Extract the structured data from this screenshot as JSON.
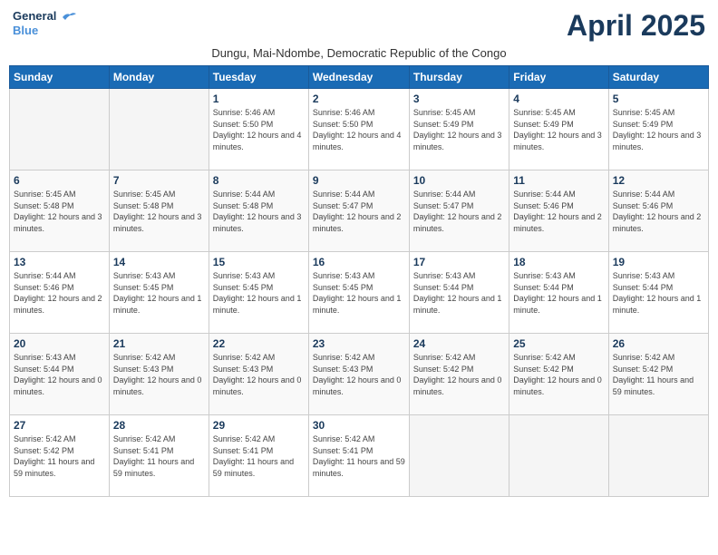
{
  "header": {
    "logo_line1": "General",
    "logo_line2": "Blue",
    "month": "April 2025",
    "subtitle": "Dungu, Mai-Ndombe, Democratic Republic of the Congo"
  },
  "days_of_week": [
    "Sunday",
    "Monday",
    "Tuesday",
    "Wednesday",
    "Thursday",
    "Friday",
    "Saturday"
  ],
  "weeks": [
    [
      {
        "num": "",
        "info": ""
      },
      {
        "num": "",
        "info": ""
      },
      {
        "num": "1",
        "info": "Sunrise: 5:46 AM\nSunset: 5:50 PM\nDaylight: 12 hours and 4 minutes."
      },
      {
        "num": "2",
        "info": "Sunrise: 5:46 AM\nSunset: 5:50 PM\nDaylight: 12 hours and 4 minutes."
      },
      {
        "num": "3",
        "info": "Sunrise: 5:45 AM\nSunset: 5:49 PM\nDaylight: 12 hours and 3 minutes."
      },
      {
        "num": "4",
        "info": "Sunrise: 5:45 AM\nSunset: 5:49 PM\nDaylight: 12 hours and 3 minutes."
      },
      {
        "num": "5",
        "info": "Sunrise: 5:45 AM\nSunset: 5:49 PM\nDaylight: 12 hours and 3 minutes."
      }
    ],
    [
      {
        "num": "6",
        "info": "Sunrise: 5:45 AM\nSunset: 5:48 PM\nDaylight: 12 hours and 3 minutes."
      },
      {
        "num": "7",
        "info": "Sunrise: 5:45 AM\nSunset: 5:48 PM\nDaylight: 12 hours and 3 minutes."
      },
      {
        "num": "8",
        "info": "Sunrise: 5:44 AM\nSunset: 5:48 PM\nDaylight: 12 hours and 3 minutes."
      },
      {
        "num": "9",
        "info": "Sunrise: 5:44 AM\nSunset: 5:47 PM\nDaylight: 12 hours and 2 minutes."
      },
      {
        "num": "10",
        "info": "Sunrise: 5:44 AM\nSunset: 5:47 PM\nDaylight: 12 hours and 2 minutes."
      },
      {
        "num": "11",
        "info": "Sunrise: 5:44 AM\nSunset: 5:46 PM\nDaylight: 12 hours and 2 minutes."
      },
      {
        "num": "12",
        "info": "Sunrise: 5:44 AM\nSunset: 5:46 PM\nDaylight: 12 hours and 2 minutes."
      }
    ],
    [
      {
        "num": "13",
        "info": "Sunrise: 5:44 AM\nSunset: 5:46 PM\nDaylight: 12 hours and 2 minutes."
      },
      {
        "num": "14",
        "info": "Sunrise: 5:43 AM\nSunset: 5:45 PM\nDaylight: 12 hours and 1 minute."
      },
      {
        "num": "15",
        "info": "Sunrise: 5:43 AM\nSunset: 5:45 PM\nDaylight: 12 hours and 1 minute."
      },
      {
        "num": "16",
        "info": "Sunrise: 5:43 AM\nSunset: 5:45 PM\nDaylight: 12 hours and 1 minute."
      },
      {
        "num": "17",
        "info": "Sunrise: 5:43 AM\nSunset: 5:44 PM\nDaylight: 12 hours and 1 minute."
      },
      {
        "num": "18",
        "info": "Sunrise: 5:43 AM\nSunset: 5:44 PM\nDaylight: 12 hours and 1 minute."
      },
      {
        "num": "19",
        "info": "Sunrise: 5:43 AM\nSunset: 5:44 PM\nDaylight: 12 hours and 1 minute."
      }
    ],
    [
      {
        "num": "20",
        "info": "Sunrise: 5:43 AM\nSunset: 5:44 PM\nDaylight: 12 hours and 0 minutes."
      },
      {
        "num": "21",
        "info": "Sunrise: 5:42 AM\nSunset: 5:43 PM\nDaylight: 12 hours and 0 minutes."
      },
      {
        "num": "22",
        "info": "Sunrise: 5:42 AM\nSunset: 5:43 PM\nDaylight: 12 hours and 0 minutes."
      },
      {
        "num": "23",
        "info": "Sunrise: 5:42 AM\nSunset: 5:43 PM\nDaylight: 12 hours and 0 minutes."
      },
      {
        "num": "24",
        "info": "Sunrise: 5:42 AM\nSunset: 5:42 PM\nDaylight: 12 hours and 0 minutes."
      },
      {
        "num": "25",
        "info": "Sunrise: 5:42 AM\nSunset: 5:42 PM\nDaylight: 12 hours and 0 minutes."
      },
      {
        "num": "26",
        "info": "Sunrise: 5:42 AM\nSunset: 5:42 PM\nDaylight: 11 hours and 59 minutes."
      }
    ],
    [
      {
        "num": "27",
        "info": "Sunrise: 5:42 AM\nSunset: 5:42 PM\nDaylight: 11 hours and 59 minutes."
      },
      {
        "num": "28",
        "info": "Sunrise: 5:42 AM\nSunset: 5:41 PM\nDaylight: 11 hours and 59 minutes."
      },
      {
        "num": "29",
        "info": "Sunrise: 5:42 AM\nSunset: 5:41 PM\nDaylight: 11 hours and 59 minutes."
      },
      {
        "num": "30",
        "info": "Sunrise: 5:42 AM\nSunset: 5:41 PM\nDaylight: 11 hours and 59 minutes."
      },
      {
        "num": "",
        "info": ""
      },
      {
        "num": "",
        "info": ""
      },
      {
        "num": "",
        "info": ""
      }
    ]
  ]
}
